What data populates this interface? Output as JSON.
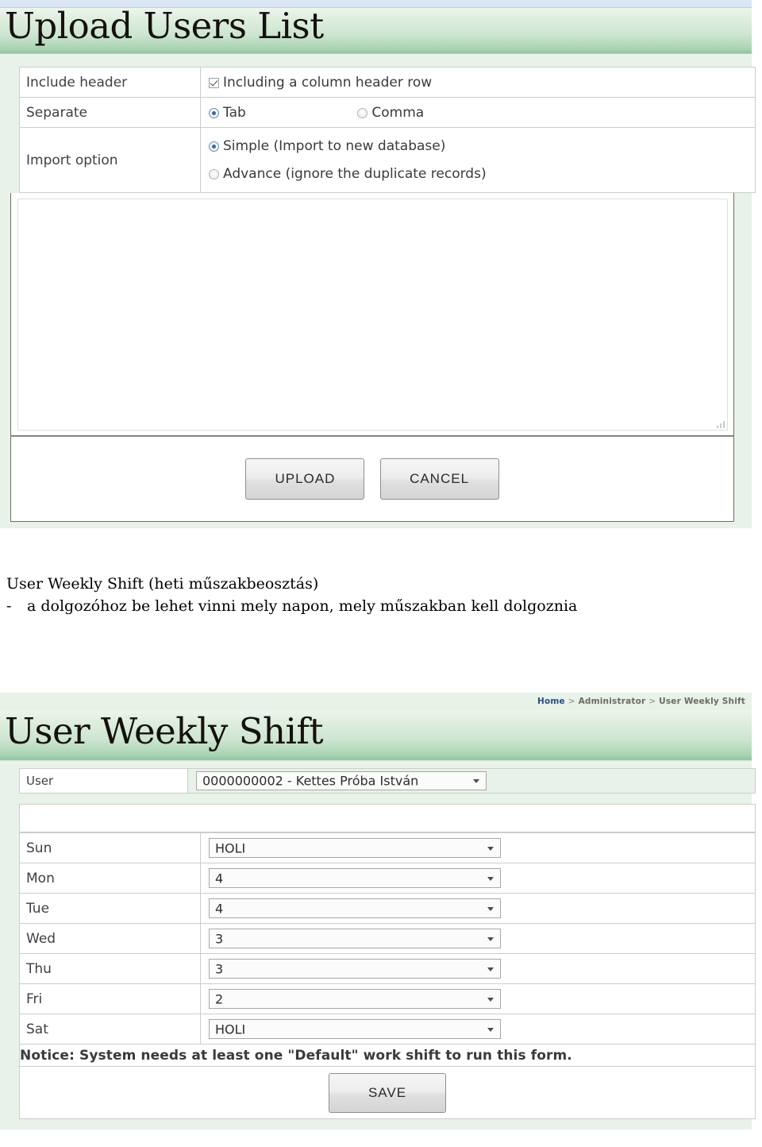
{
  "upload_panel": {
    "title": "Upload Users List",
    "rows": [
      {
        "label": "Include header",
        "options": [
          {
            "type": "checkbox",
            "checked": true,
            "label": "Including a column header row"
          }
        ]
      },
      {
        "label": "Separate",
        "options": [
          {
            "type": "radio",
            "checked": true,
            "label": "Tab"
          },
          {
            "type": "radio",
            "checked": false,
            "label": "Comma"
          }
        ]
      },
      {
        "label": "Import option",
        "options": [
          {
            "type": "radio",
            "checked": true,
            "label": "Simple (Import to new database)"
          },
          {
            "type": "radio",
            "checked": false,
            "label": "Advance (ignore the duplicate records)"
          }
        ]
      }
    ],
    "textarea_value": "",
    "buttons": {
      "upload": "UPLOAD",
      "cancel": "CANCEL"
    }
  },
  "prose": {
    "line1": "User Weekly Shift (heti műszakbeosztás)",
    "line2_dash": "-",
    "line2": "a dolgozóhoz be lehet vinni mely napon, mely műszakban kell dolgoznia"
  },
  "shift_panel": {
    "title": "User Weekly Shift",
    "breadcrumb": {
      "home": "Home",
      "sep1": ">",
      "administrator": "Administrator",
      "sep2": ">",
      "current": "User Weekly Shift"
    },
    "user_row": {
      "label": "User",
      "value": "0000000002 - Kettes Próba István"
    },
    "days": [
      {
        "label": "Sun",
        "value": "HOLI"
      },
      {
        "label": "Mon",
        "value": "4"
      },
      {
        "label": "Tue",
        "value": "4"
      },
      {
        "label": "Wed",
        "value": "3"
      },
      {
        "label": "Thu",
        "value": "3"
      },
      {
        "label": "Fri",
        "value": "2"
      },
      {
        "label": "Sat",
        "value": "HOLI"
      }
    ],
    "notice": "Notice: System needs at least one \"Default\" work shift to run this form.",
    "save_label": "SAVE"
  },
  "colors": {
    "header_green": "#8ec49c",
    "panel_bg": "#e8f2e8",
    "topbar_blue": "#dbe6f4",
    "notice_orange": "#c1440e",
    "link_blue": "#2b4d86"
  }
}
